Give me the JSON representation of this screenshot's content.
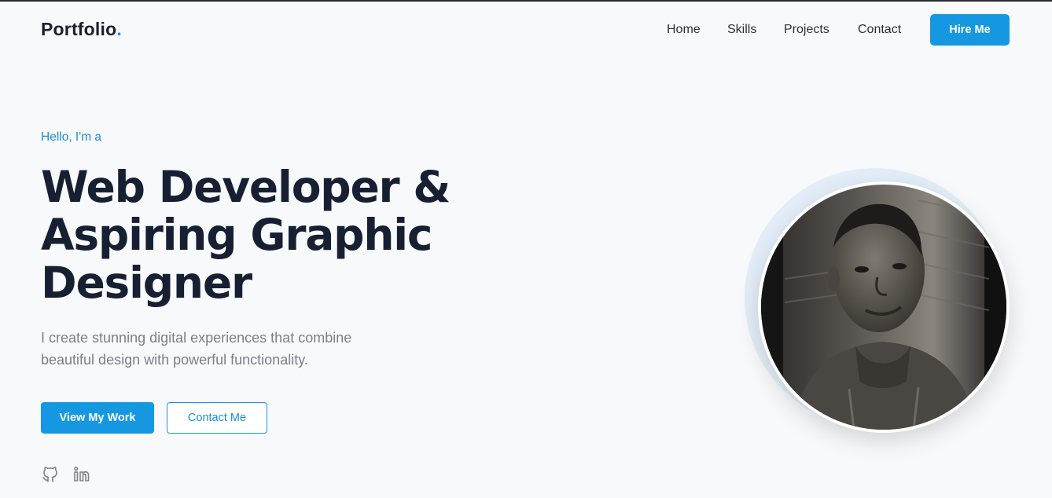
{
  "nav": {
    "logo_text": "Portfolio",
    "logo_dot": ".",
    "links": [
      "Home",
      "Skills",
      "Projects",
      "Contact"
    ],
    "hire_label": "Hire Me"
  },
  "hero": {
    "greeting": "Hello, I'm a",
    "headline_lines": [
      "Web Developer &",
      "Aspiring Graphic",
      "Designer"
    ],
    "description": "I create stunning digital experiences that combine beautiful design with powerful functionality.",
    "primary_button": "View My Work",
    "secondary_button": "Contact Me",
    "social_icons": [
      "github-icon",
      "linkedin-icon"
    ]
  },
  "colors": {
    "accent": "#1598e1",
    "background": "#f8f9fb",
    "text": "#172033"
  }
}
